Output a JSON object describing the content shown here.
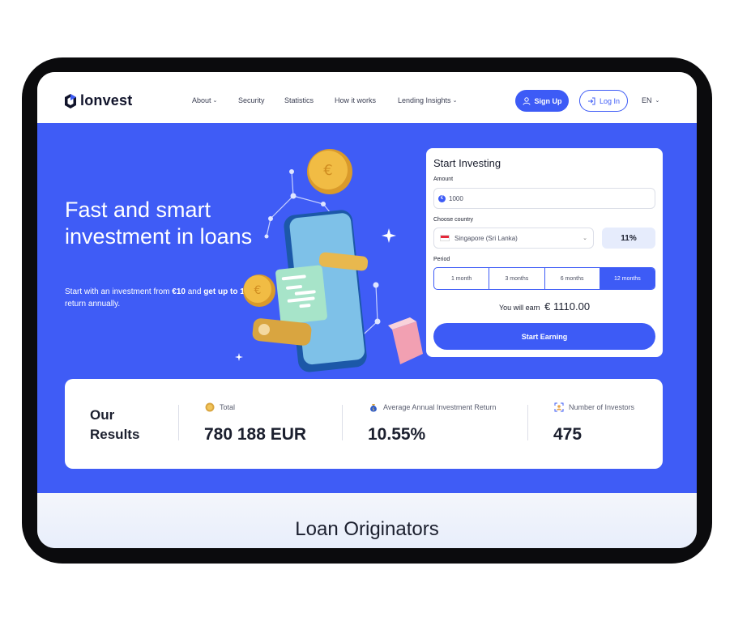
{
  "brand": {
    "name": "lonvest",
    "accent": "#3f5cf6"
  },
  "nav": {
    "items": [
      {
        "label": "About",
        "has_dropdown": true
      },
      {
        "label": "Security",
        "has_dropdown": false
      },
      {
        "label": "Statistics",
        "has_dropdown": false
      },
      {
        "label": "How it works",
        "has_dropdown": false
      },
      {
        "label": "Lending Insights",
        "has_dropdown": true
      }
    ],
    "signup_label": "Sign Up",
    "login_label": "Log In",
    "language": "EN"
  },
  "hero": {
    "title": "Fast and smart investment in loans",
    "subtitle_prefix": "Start with an investment from ",
    "subtitle_min": "€10",
    "subtitle_mid": " and ",
    "subtitle_bold": "get up to 15%",
    "subtitle_suffix": " return annually."
  },
  "invest_card": {
    "title": "Start Investing",
    "amount_label": "Amount",
    "amount_value": "1000",
    "country_label": "Choose country",
    "country_value": "Singapore (Sri Lanka)",
    "rate": "11%",
    "period_label": "Period",
    "periods": [
      "1 month",
      "3 months",
      "6 months",
      "12 months"
    ],
    "selected_period": "12 months",
    "earn_label": "You will earn",
    "earn_value": "€ 1110.00",
    "cta_label": "Start Earning"
  },
  "results": {
    "title_line1": "Our",
    "title_line2": "Results",
    "stats": [
      {
        "label": "Total",
        "value": "780 188 EUR",
        "icon": "coin-icon"
      },
      {
        "label": "Average Annual Investment Return",
        "value": "10.55%",
        "icon": "money-bag-icon"
      },
      {
        "label": "Number of Investors",
        "value": "475",
        "icon": "investor-icon"
      }
    ]
  },
  "bottom_section": {
    "title": "Loan Originators"
  }
}
